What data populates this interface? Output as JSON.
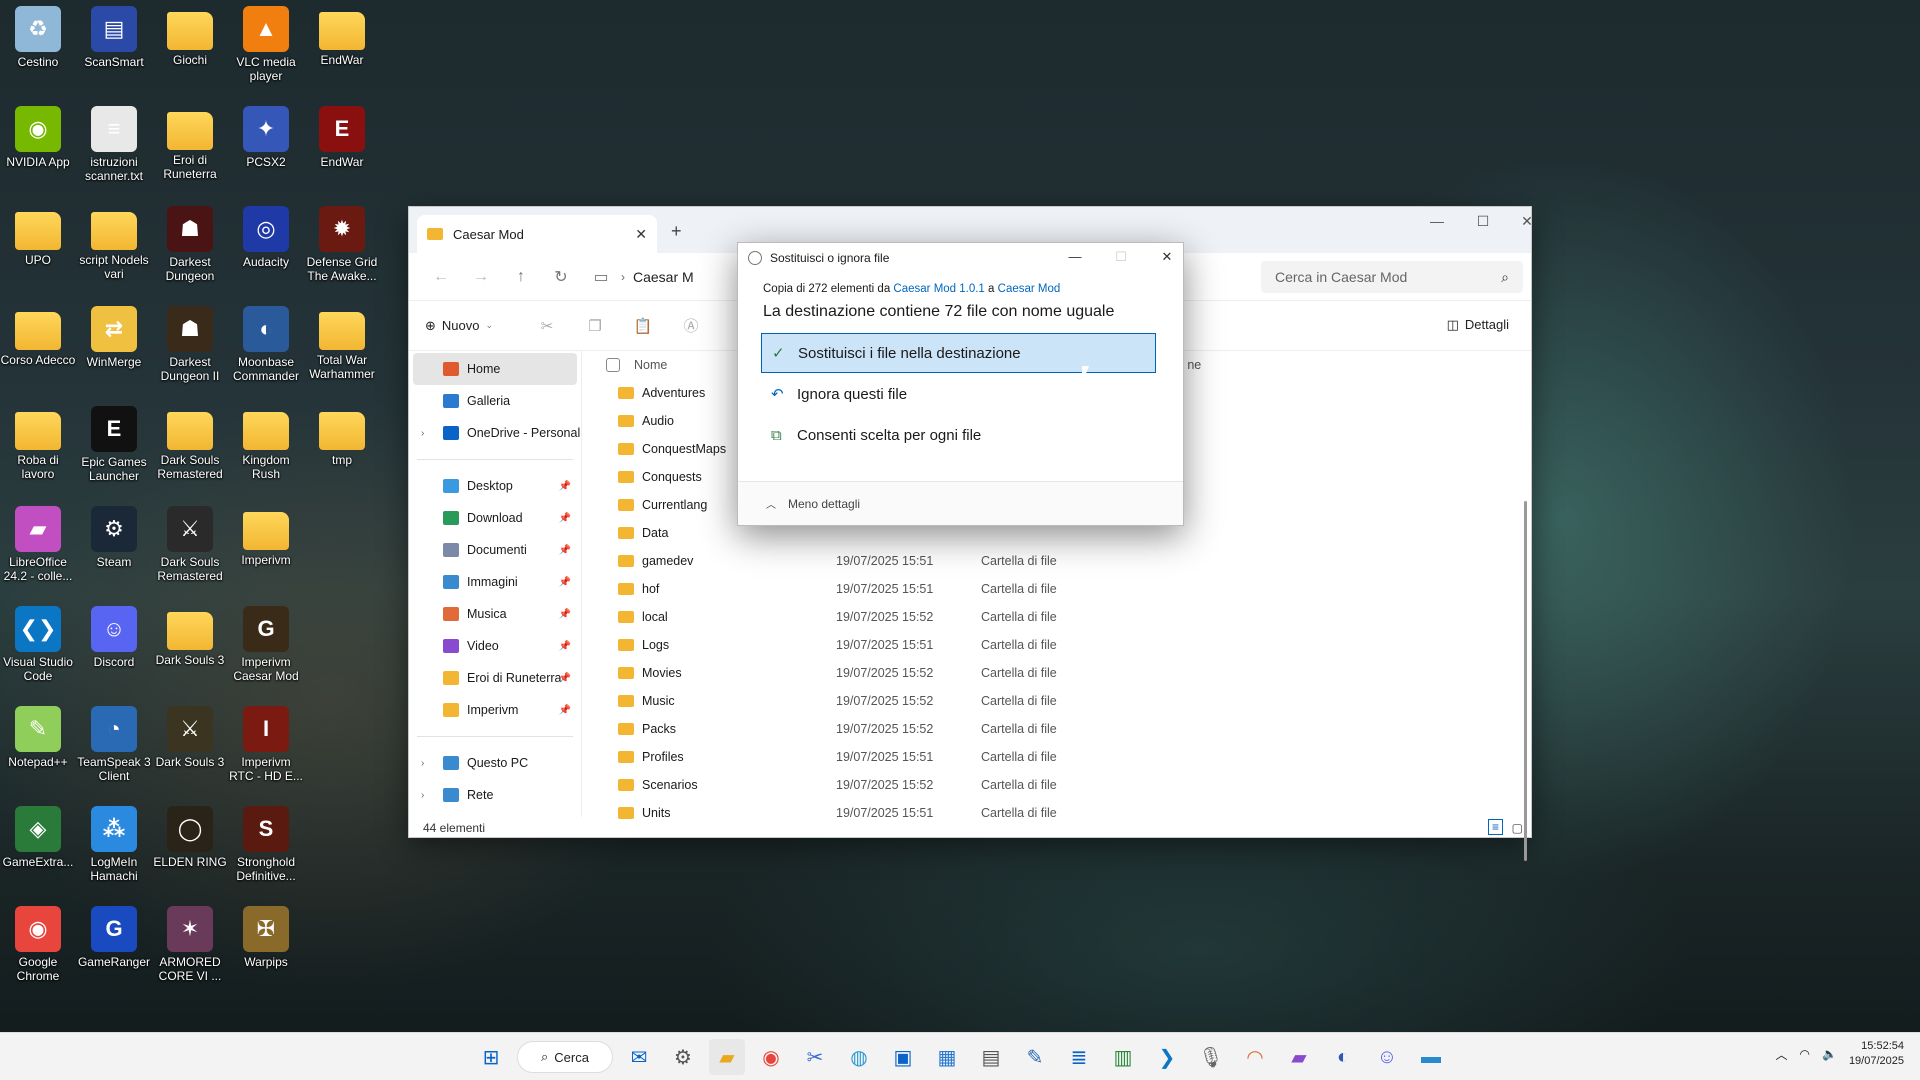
{
  "desktop": {
    "icons": [
      {
        "label": "Cestino",
        "color": "#8fb8d8",
        "glyph": "♻",
        "folder": false
      },
      {
        "label": "ScanSmart",
        "color": "#2b4aa8",
        "glyph": "▤",
        "folder": false
      },
      {
        "label": "Giochi",
        "color": "",
        "glyph": "",
        "folder": true
      },
      {
        "label": "VLC media player",
        "color": "#f07f10",
        "glyph": "▲",
        "folder": false
      },
      {
        "label": "EndWar",
        "color": "",
        "glyph": "",
        "folder": true
      },
      {
        "label": "NVIDIA App",
        "color": "#76b900",
        "glyph": "◉",
        "folder": false
      },
      {
        "label": "istruzioni scanner.txt",
        "color": "#e8e8e8",
        "glyph": "≡",
        "folder": false
      },
      {
        "label": "Eroi di Runeterra",
        "color": "",
        "glyph": "",
        "folder": true
      },
      {
        "label": "PCSX2",
        "color": "#3557b7",
        "glyph": "✦",
        "folder": false
      },
      {
        "label": "EndWar",
        "color": "#8a1010",
        "glyph": "E",
        "folder": false
      },
      {
        "label": "UPO",
        "color": "",
        "glyph": "",
        "folder": true
      },
      {
        "label": "script Nodels vari",
        "color": "",
        "glyph": "",
        "folder": true
      },
      {
        "label": "Darkest Dungeon",
        "color": "#4a1414",
        "glyph": "☗",
        "folder": false
      },
      {
        "label": "Audacity",
        "color": "#1f3aa6",
        "glyph": "◎",
        "folder": false
      },
      {
        "label": "Defense Grid The Awake...",
        "color": "#6a1a10",
        "glyph": "✹",
        "folder": false
      },
      {
        "label": "Corso Adecco",
        "color": "",
        "glyph": "",
        "folder": true
      },
      {
        "label": "WinMerge",
        "color": "#f0c040",
        "glyph": "⇄",
        "folder": false
      },
      {
        "label": "Darkest Dungeon II",
        "color": "#3a2a1a",
        "glyph": "☗",
        "folder": false
      },
      {
        "label": "Moonbase Commander",
        "color": "#2a5a9a",
        "glyph": "◐",
        "folder": false
      },
      {
        "label": "Total War Warhammer",
        "color": "",
        "glyph": "",
        "folder": true
      },
      {
        "label": "Roba di lavoro",
        "color": "",
        "glyph": "",
        "folder": true
      },
      {
        "label": "Epic Games Launcher",
        "color": "#111111",
        "glyph": "E",
        "folder": false
      },
      {
        "label": "Dark Souls Remastered",
        "color": "",
        "glyph": "",
        "folder": true
      },
      {
        "label": "Kingdom Rush",
        "color": "",
        "glyph": "",
        "folder": true
      },
      {
        "label": "tmp",
        "color": "",
        "glyph": "",
        "folder": true
      },
      {
        "label": "LibreOffice 24.2 - colle...",
        "color": "#c24fc2",
        "glyph": "▰",
        "folder": false
      },
      {
        "label": "Steam",
        "color": "#1b2838",
        "glyph": "⚙",
        "folder": false
      },
      {
        "label": "Dark Souls Remastered",
        "color": "#2a2a2a",
        "glyph": "⚔",
        "folder": false
      },
      {
        "label": "Imperivm",
        "color": "",
        "glyph": "",
        "folder": true
      },
      {
        "label": "Visual Studio Code",
        "color": "#0a76c4",
        "glyph": "❮❯",
        "folder": false
      },
      {
        "label": "Discord",
        "color": "#5865f2",
        "glyph": "☺",
        "folder": false
      },
      {
        "label": "Dark Souls 3",
        "color": "",
        "glyph": "",
        "folder": true
      },
      {
        "label": "Imperivm Caesar Mod",
        "color": "#3a2a18",
        "glyph": "G",
        "folder": false
      },
      {
        "label": "Notepad++",
        "color": "#8fce5a",
        "glyph": "✎",
        "folder": false
      },
      {
        "label": "TeamSpeak 3 Client",
        "color": "#2a6ab5",
        "glyph": "◔",
        "folder": false
      },
      {
        "label": "Dark Souls 3",
        "color": "#3a3420",
        "glyph": "⚔",
        "folder": false
      },
      {
        "label": "Imperivm RTC - HD E...",
        "color": "#7a1a10",
        "glyph": "I",
        "folder": false
      },
      {
        "label": "GameExtra...",
        "color": "#2a7a3a",
        "glyph": "◈",
        "folder": false
      },
      {
        "label": "LogMeIn Hamachi",
        "color": "#2a8ae0",
        "glyph": "⁂",
        "folder": false
      },
      {
        "label": "ELDEN RING",
        "color": "#2a2418",
        "glyph": "◯",
        "folder": false
      },
      {
        "label": "Stronghold Definitive...",
        "color": "#5a1a10",
        "glyph": "S",
        "folder": false
      },
      {
        "label": "Google Chrome",
        "color": "#e8453c",
        "glyph": "◉",
        "folder": false
      },
      {
        "label": "GameRanger",
        "color": "#1a4ac0",
        "glyph": "G",
        "folder": false
      },
      {
        "label": "ARMORED CORE VI ...",
        "color": "#6a3a5a",
        "glyph": "✶",
        "folder": false
      },
      {
        "label": "Warpips",
        "color": "#8a6a2a",
        "glyph": "✠",
        "folder": false
      }
    ]
  },
  "explorer": {
    "tab_title": "Caesar Mod",
    "breadcrumb": "Caesar M",
    "search_placeholder": "Cerca in Caesar Mod",
    "new_label": "Nuovo",
    "details_label": "Dettagli",
    "col_name": "Nome",
    "col_tail": "ne",
    "status": "44 elementi",
    "nav": [
      {
        "label": "Home",
        "color": "#e05a30",
        "selected": true,
        "pin": false,
        "chev": false
      },
      {
        "label": "Galleria",
        "color": "#2a7ad0",
        "selected": false,
        "pin": false,
        "chev": false
      },
      {
        "label": "OneDrive - Personal",
        "color": "#0a64c8",
        "selected": false,
        "pin": false,
        "chev": true
      },
      {
        "label": "Desktop",
        "color": "#3a9ae0",
        "selected": false,
        "pin": true,
        "chev": false
      },
      {
        "label": "Download",
        "color": "#2a9a5a",
        "selected": false,
        "pin": true,
        "chev": false
      },
      {
        "label": "Documenti",
        "color": "#7a8aa8",
        "selected": false,
        "pin": true,
        "chev": false
      },
      {
        "label": "Immagini",
        "color": "#3a8ad0",
        "selected": false,
        "pin": true,
        "chev": false
      },
      {
        "label": "Musica",
        "color": "#e06a3a",
        "selected": false,
        "pin": true,
        "chev": false
      },
      {
        "label": "Video",
        "color": "#8a4ad0",
        "selected": false,
        "pin": true,
        "chev": false
      },
      {
        "label": "Eroi di Runeterra",
        "color": "#f2b632",
        "selected": false,
        "pin": true,
        "chev": false
      },
      {
        "label": "Imperivm",
        "color": "#f2b632",
        "selected": false,
        "pin": true,
        "chev": false
      },
      {
        "label": "Questo PC",
        "color": "#3a8ad0",
        "selected": false,
        "pin": false,
        "chev": true
      },
      {
        "label": "Rete",
        "color": "#3a8ad0",
        "selected": false,
        "pin": false,
        "chev": true
      }
    ],
    "files": [
      {
        "name": "Adventures",
        "date": "",
        "type": ""
      },
      {
        "name": "Audio",
        "date": "",
        "type": ""
      },
      {
        "name": "ConquestMaps",
        "date": "",
        "type": ""
      },
      {
        "name": "Conquests",
        "date": "",
        "type": ""
      },
      {
        "name": "Currentlang",
        "date": "",
        "type": ""
      },
      {
        "name": "Data",
        "date": "",
        "type": ""
      },
      {
        "name": "gamedev",
        "date": "19/07/2025 15:51",
        "type": "Cartella di file"
      },
      {
        "name": "hof",
        "date": "19/07/2025 15:51",
        "type": "Cartella di file"
      },
      {
        "name": "local",
        "date": "19/07/2025 15:52",
        "type": "Cartella di file"
      },
      {
        "name": "Logs",
        "date": "19/07/2025 15:51",
        "type": "Cartella di file"
      },
      {
        "name": "Movies",
        "date": "19/07/2025 15:52",
        "type": "Cartella di file"
      },
      {
        "name": "Music",
        "date": "19/07/2025 15:52",
        "type": "Cartella di file"
      },
      {
        "name": "Packs",
        "date": "19/07/2025 15:52",
        "type": "Cartella di file"
      },
      {
        "name": "Profiles",
        "date": "19/07/2025 15:51",
        "type": "Cartella di file"
      },
      {
        "name": "Scenarios",
        "date": "19/07/2025 15:52",
        "type": "Cartella di file"
      },
      {
        "name": "Units",
        "date": "19/07/2025 15:51",
        "type": "Cartella di file"
      }
    ]
  },
  "dialog": {
    "title": "Sostituisci o ignora file",
    "copy_prefix": "Copia di 272 elementi da ",
    "source": "Caesar Mod 1.0.1",
    "copy_mid": " a ",
    "dest": "Caesar Mod",
    "heading": "La destinazione contiene 72 file con nome uguale",
    "opt_replace": "Sostituisci i file nella destinazione",
    "opt_skip": "Ignora questi file",
    "opt_choose": "Consenti scelta per ogni file",
    "less_details": "Meno dettagli"
  },
  "taskbar": {
    "search_label": "Cerca",
    "time": "15:52:54",
    "date": "19/07/2025"
  }
}
